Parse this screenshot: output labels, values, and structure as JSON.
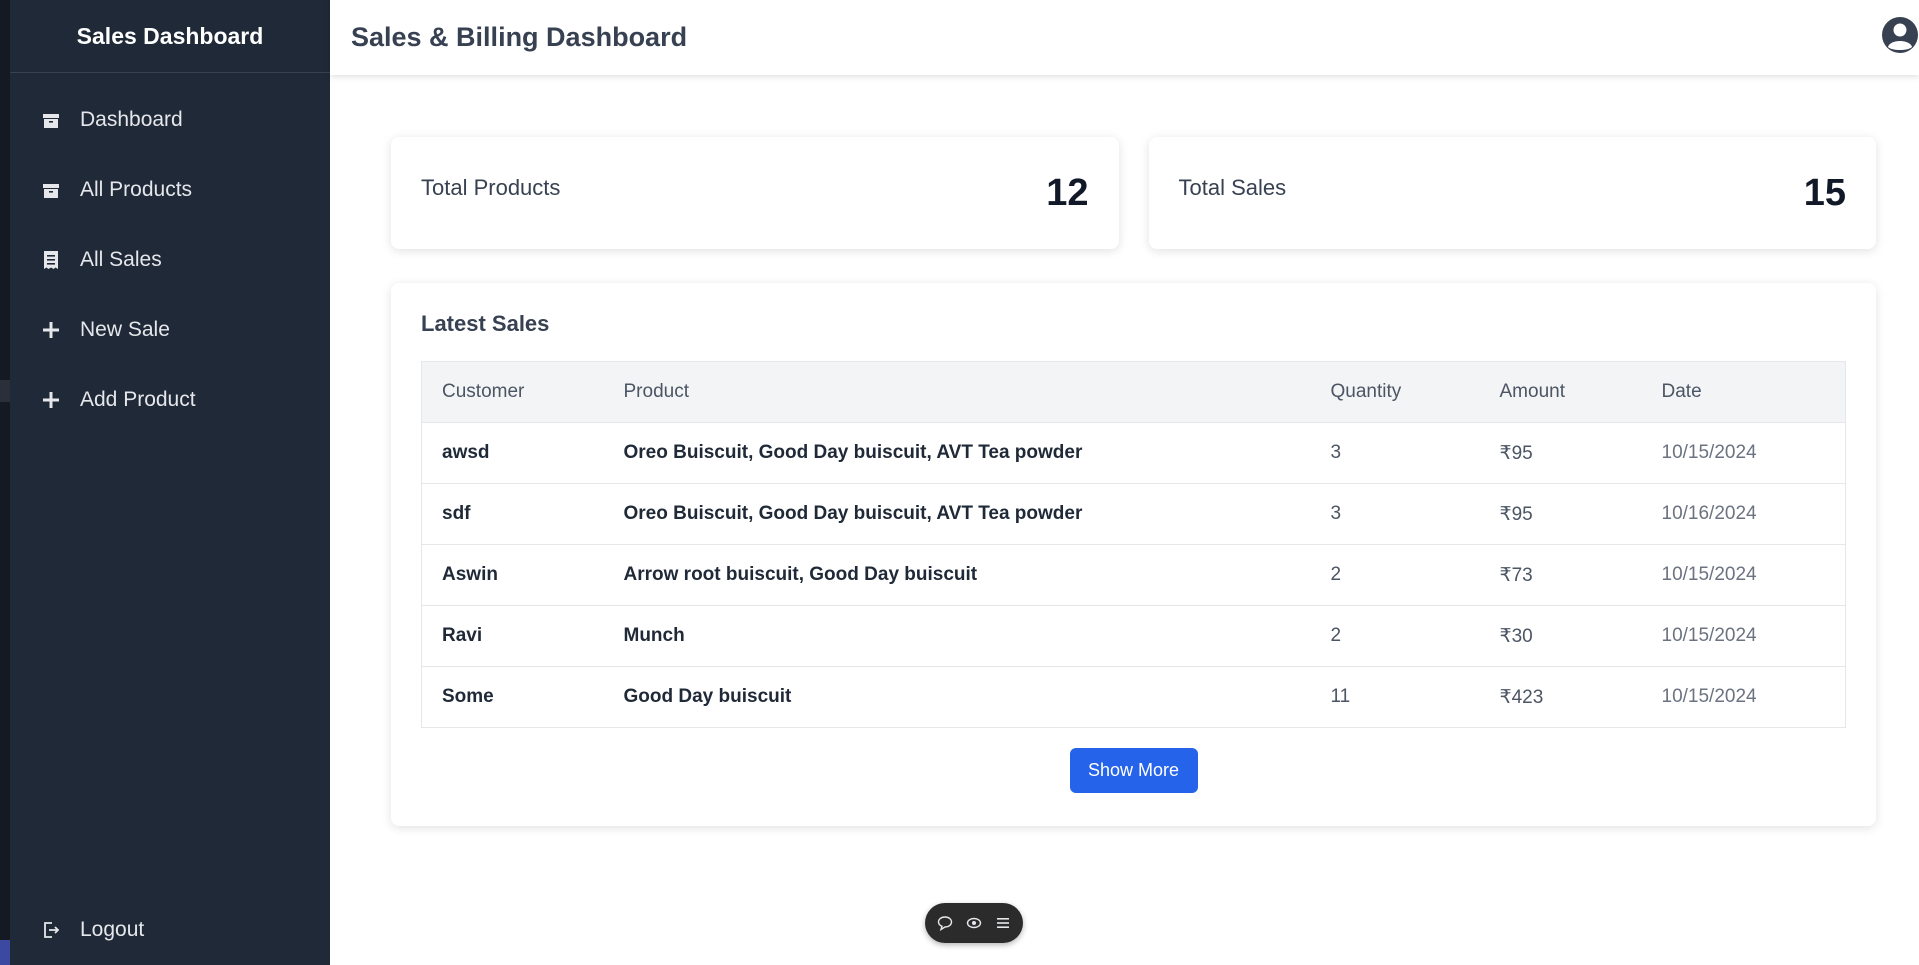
{
  "sidebar": {
    "title": "Sales Dashboard",
    "items": [
      {
        "label": "Dashboard",
        "icon": "box-icon"
      },
      {
        "label": "All Products",
        "icon": "box-icon"
      },
      {
        "label": "All Sales",
        "icon": "receipt-icon"
      },
      {
        "label": "New Sale",
        "icon": "plus-icon"
      },
      {
        "label": "Add Product",
        "icon": "plus-icon"
      }
    ],
    "logout_label": "Logout"
  },
  "header": {
    "title": "Sales & Billing Dashboard",
    "avatar_icon": "user-circle-icon"
  },
  "stats": {
    "total_products_label": "Total Products",
    "total_products_value": "12",
    "total_sales_label": "Total Sales",
    "total_sales_value": "15"
  },
  "latest_sales": {
    "title": "Latest Sales",
    "columns": [
      "Customer",
      "Product",
      "Quantity",
      "Amount",
      "Date"
    ],
    "rows": [
      {
        "customer": "awsd",
        "product": "Oreo Buiscuit, Good Day buiscuit, AVT Tea powder",
        "quantity": "3",
        "amount": "₹95",
        "date": "10/15/2024"
      },
      {
        "customer": "sdf",
        "product": "Oreo Buiscuit, Good Day buiscuit, AVT Tea powder",
        "quantity": "3",
        "amount": "₹95",
        "date": "10/16/2024"
      },
      {
        "customer": "Aswin",
        "product": "Arrow root buiscuit, Good Day buiscuit",
        "quantity": "2",
        "amount": "₹73",
        "date": "10/15/2024"
      },
      {
        "customer": "Ravi",
        "product": "Munch",
        "quantity": "2",
        "amount": "₹30",
        "date": "10/15/2024"
      },
      {
        "customer": "Some",
        "product": "Good Day buiscuit",
        "quantity": "11",
        "amount": "₹423",
        "date": "10/15/2024"
      }
    ],
    "show_more_label": "Show More"
  },
  "floating_toolbar": {
    "icons": [
      "chat-icon",
      "eye-icon",
      "menu-icon"
    ]
  },
  "colors": {
    "sidebar_bg": "#1f2937",
    "accent": "#2563eb"
  }
}
